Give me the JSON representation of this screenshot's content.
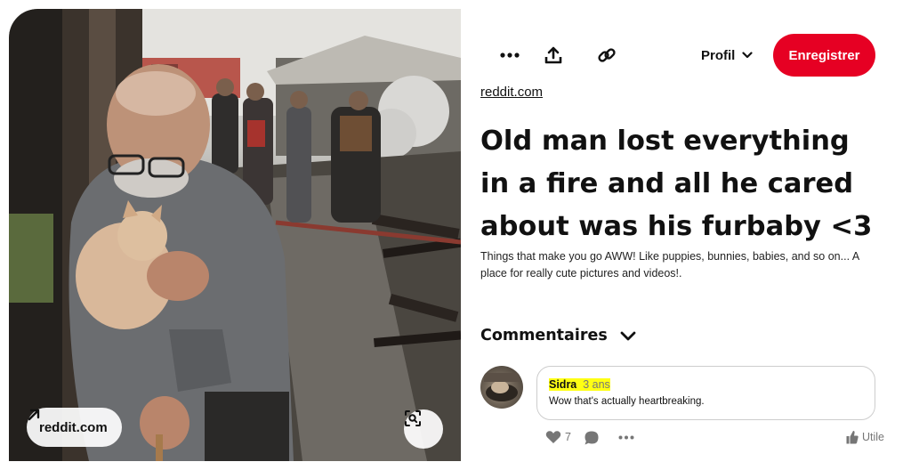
{
  "image": {
    "source_pill_label": "reddit.com"
  },
  "toolbar": {
    "more_icon": "more-dots-icon",
    "share_icon": "share-upload-icon",
    "link_icon": "link-chain-icon",
    "profile_label": "Profil",
    "save_label": "Enregistrer"
  },
  "pin": {
    "source": "reddit.com",
    "title": "Old man lost everything in a fire and all he cared about was his furbaby <3",
    "description": "Things that make you go AWW! Like puppies, bunnies, babies, and so on... A place for really cute pictures and videos!."
  },
  "comments": {
    "heading": "Commentaires",
    "items": [
      {
        "author": "Sidra",
        "time": "3 ans",
        "text": "Wow that's actually heartbreaking.",
        "likes": "7",
        "helpful_label": "Utile"
      }
    ]
  },
  "colors": {
    "accent": "#e60023",
    "highlight": "#ffff14",
    "muted_text": "#767676"
  }
}
